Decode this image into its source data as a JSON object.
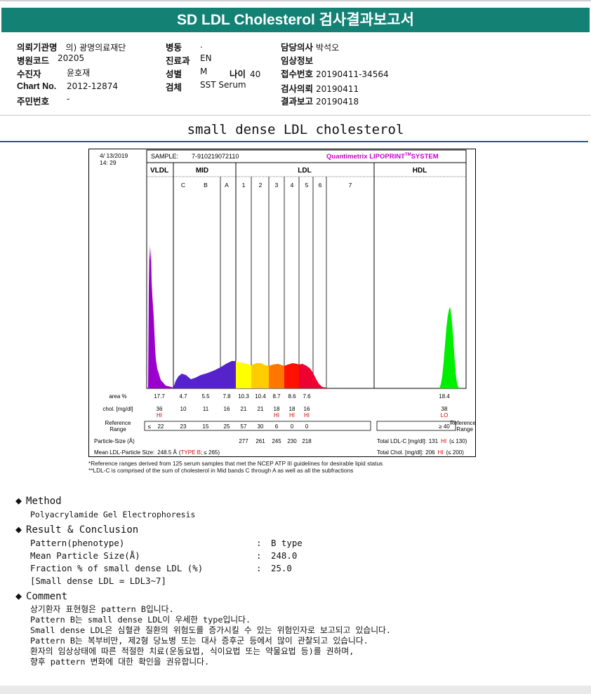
{
  "report": {
    "title": "SD LDL Cholesterol 검사결과보고서",
    "subtitle": "small dense LDL cholesterol"
  },
  "info": {
    "institution_label": "의뢰기관명",
    "institution": "의) 광명의료재단",
    "hospital_code_label": "병원코드",
    "hospital_code": "20205",
    "recipient_label": "수진자",
    "recipient": "윤호재",
    "chart_no_label": "Chart No.",
    "chart_no": "2012-12874",
    "resident_no_label": "주민번호",
    "resident_no": "-",
    "ward_label": "병동",
    "ward": ".",
    "department_label": "진료과",
    "department": "EN",
    "sex_label": "성별",
    "sex": "M",
    "age_label": "나이",
    "age": "40",
    "specimen_label": "검체",
    "specimen": "SST Serum",
    "doctor_label": "담당의사",
    "doctor": "박석오",
    "clinical_info_label": "임상정보",
    "clinical_info": "",
    "receipt_no_label": "접수번호",
    "receipt_no": "20190411-34564",
    "request_date_label": "검사의뢰",
    "request_date": "20190411",
    "report_date_label": "결과보고",
    "report_date": "20190418"
  },
  "lipoprint": {
    "date": "4/ 13/2019",
    "time": "14: 29",
    "sample_label": "SAMPLE:",
    "sample_id": "7-910219072110",
    "system_name": "Quantimetrix LIPOPRINT",
    "system_tm": "TM",
    "system_suffix": "SYSTEM",
    "groups": [
      "VLDL",
      "MID",
      "LDL",
      "HDL"
    ],
    "bands": [
      "C",
      "B",
      "A",
      "1",
      "2",
      "3",
      "4",
      "5",
      "6",
      "7"
    ],
    "row_labels": {
      "area": "area %",
      "chol": "chol. [mg/dl]",
      "ref1": "Reference",
      "ref2": "Range",
      "particle": "Particle-Size (Å)",
      "mean": "Mean LDL-Particle Size:"
    },
    "mean_value": "248.5 Å",
    "mean_type": "TYPE B",
    "mean_ref": "≤ 265",
    "total_ldl_label": "Total LDL-C [mg/dl]:",
    "total_ldl_value": "131",
    "total_ldl_flag": "HI",
    "total_ldl_ref": "(≤ 130)",
    "total_chol_label": "Total Chol. [mg/dl]:",
    "total_chol_value": "206",
    "total_chol_flag": "HI",
    "total_chol_ref": "(≤ 200)",
    "hdl_ref": "≥ 40",
    "vldl_ref_sym": "≤",
    "footnote1": "*Reference ranges derived from 125 serum samples that met the NCEP ATP III guidelines for desirable lipid status",
    "footnote2": "**LDL-C is comprised of the sum of cholesterol in Mid bands C through A as well as all the subfractions"
  },
  "chart_data": {
    "type": "table",
    "columns": [
      "VLDL",
      "C",
      "B",
      "A",
      "1",
      "2",
      "3",
      "4",
      "5",
      "6",
      "7",
      "HDL"
    ],
    "area_percent": [
      "17.7",
      "4.7",
      "5.5",
      "7.8",
      "10.3",
      "10.4",
      "8.7",
      "8.6",
      "7.6",
      "",
      "",
      "18.4"
    ],
    "chol_mg_dl": [
      "36",
      "10",
      "11",
      "16",
      "21",
      "21",
      "18",
      "18",
      "16",
      "",
      "",
      "38"
    ],
    "flags": [
      "HI",
      "",
      "",
      "",
      "",
      "",
      "HI",
      "HI",
      "HI",
      "",
      "",
      "LO"
    ],
    "reference_range": [
      "22",
      "23",
      "15",
      "25",
      "57",
      "30",
      "6",
      "0",
      "0",
      "",
      "",
      "≥ 40"
    ],
    "particle_size": [
      "",
      "",
      "",
      "",
      "277",
      "261",
      "245",
      "230",
      "218",
      "",
      "",
      ""
    ],
    "colors": {
      "VLDL": "#9900cc",
      "MID": "#5522cc",
      "1": "#ffff00",
      "2": "#ffcc00",
      "3": "#ff7700",
      "4": "#ff1100",
      "5": "#ee0033",
      "HDL": "#00ee00"
    }
  },
  "method": {
    "heading": "Method",
    "text": "Polyacrylamide Gel Electrophoresis"
  },
  "result": {
    "heading": "Result & Conclusion",
    "rows": [
      {
        "label": "Pattern(phenotype)",
        "sep": ":",
        "value": "B type"
      },
      {
        "label": "Mean Particle Size(Å)",
        "sep": ":",
        "value": "248.0"
      },
      {
        "label": "Fraction % of small dense LDL (%)",
        "sep": ":",
        "value": "25.0"
      }
    ],
    "note": "[Small dense LDL = LDL3~7]"
  },
  "comment": {
    "heading": "Comment",
    "lines": [
      "상기환자 표현형은 pattern B입니다.",
      "Pattern B는 small dense LDL이 우세한 type입니다.",
      "Small dense LDL은 심혈관 질환의 위험도를 증가시킬 수 있는 위험인자로 보고되고 있습니다.",
      "Pattern B는 복부비만, 제2형 당뇨병 또는 대사 증후군 등에서 많이 관찰되고 있습니다.",
      "환자의 임상상태에 따른 적절한 치료(운동요법, 식이요법 또는 약물요법 등)를 권하며,",
      "향후 pattern 변화에 대한 확인을 권유합니다."
    ]
  }
}
